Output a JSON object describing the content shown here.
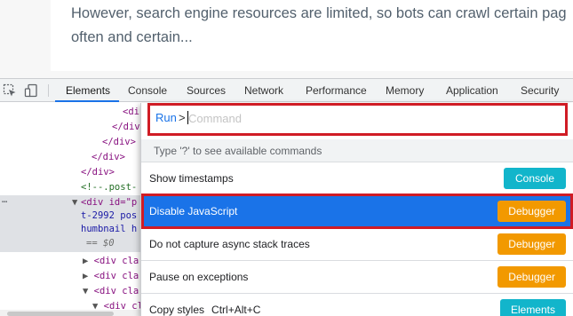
{
  "article": {
    "line1": "However, search engine resources are limited, so bots can crawl certain pag",
    "line2": "often and certain..."
  },
  "devtools": {
    "tabs": [
      {
        "label": "Elements"
      },
      {
        "label": "Console"
      },
      {
        "label": "Sources"
      },
      {
        "label": "Network"
      },
      {
        "label": "Performance"
      },
      {
        "label": "Memory"
      },
      {
        "label": "Application"
      },
      {
        "label": "Security"
      }
    ],
    "active_tab": "Elements",
    "toolbar_icons": [
      "inspect-element-icon",
      "device-toolbar-icon"
    ]
  },
  "elements_panel": {
    "lines": {
      "l1": "<di",
      "l2": "</div>",
      "l3": "</div>",
      "l4": "</div>",
      "l5": "</div>",
      "l6": "<!--.post-",
      "l7a": "<div id=\"p",
      "l7b": "t-2992 pos",
      "l7c": "humbnail h",
      "l7d": "== $0",
      "l8": "<div cla",
      "l9": "<div cla",
      "l10": "<div cla",
      "l11": "<div cl"
    },
    "ellipsis": "…"
  },
  "command_menu": {
    "prefix": "Run",
    "gt": ">",
    "placeholder": "Command",
    "value": "",
    "hint": "Type '?' to see available commands",
    "items": [
      {
        "label": "Show timestamps",
        "shortcut": "",
        "badge": "Console",
        "badge_color": "#12b5cb"
      },
      {
        "label": "Disable JavaScript",
        "shortcut": "",
        "badge": "Debugger",
        "badge_color": "#f29900",
        "selected": true
      },
      {
        "label": "Do not capture async stack traces",
        "shortcut": "",
        "badge": "Debugger",
        "badge_color": "#f29900"
      },
      {
        "label": "Pause on exceptions",
        "shortcut": "",
        "badge": "Debugger",
        "badge_color": "#f29900"
      },
      {
        "label": "Copy styles",
        "shortcut": "Ctrl+Alt+C",
        "badge": "Elements",
        "badge_color": "#12b5cb"
      }
    ]
  },
  "colors": {
    "accent": "#1a73e8",
    "highlight_frame": "#d01c25",
    "badge_console": "#12b5cb",
    "badge_debugger": "#f29900"
  }
}
